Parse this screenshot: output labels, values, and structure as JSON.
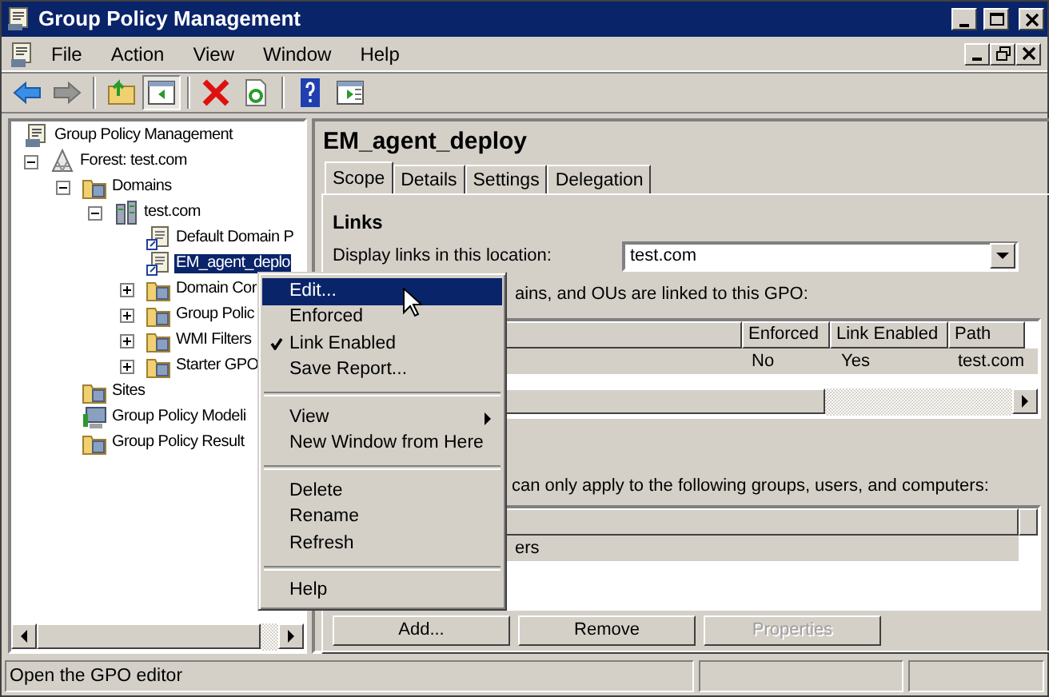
{
  "window": {
    "title": "Group Policy Management"
  },
  "menu_bar": [
    "File",
    "Action",
    "View",
    "Window",
    "Help"
  ],
  "toolbar": [
    {
      "kind": "back",
      "disabled": false
    },
    {
      "kind": "forward",
      "disabled": true
    },
    {
      "kind": "separator"
    },
    {
      "kind": "up",
      "disabled": false
    },
    {
      "kind": "tree",
      "disabled": false,
      "pressed": true
    },
    {
      "kind": "separator"
    },
    {
      "kind": "delete",
      "disabled": false
    },
    {
      "kind": "refresh",
      "disabled": false
    },
    {
      "kind": "separator"
    },
    {
      "kind": "help",
      "disabled": false
    },
    {
      "kind": "pane",
      "disabled": false
    }
  ],
  "tree": [
    {
      "label": "Group Policy Management",
      "kind": "console",
      "selected": false,
      "children": [
        {
          "label": "Forest: test.com",
          "kind": "forest",
          "expanded": true,
          "selected": false,
          "children": [
            {
              "label": "Domains",
              "kind": "folder",
              "expanded": true,
              "selected": false,
              "children": [
                {
                  "label": "test.com",
                  "kind": "domain",
                  "expanded": true,
                  "selected": false,
                  "children": [
                    {
                      "label": "Default Domain P",
                      "kind": "gpo",
                      "selected": false
                    },
                    {
                      "label": "EM_agent_deplo",
                      "kind": "gpo",
                      "selected": true
                    },
                    {
                      "label": "Domain Cor",
                      "kind": "folder",
                      "expanded": false,
                      "selected": false
                    },
                    {
                      "label": "Group Polic",
                      "kind": "folder",
                      "expanded": false,
                      "selected": false
                    },
                    {
                      "label": "WMI Filters",
                      "kind": "folder",
                      "expanded": false,
                      "selected": false
                    },
                    {
                      "label": "Starter GPO",
                      "kind": "folder",
                      "expanded": false,
                      "selected": false
                    }
                  ]
                }
              ]
            },
            {
              "label": "Sites",
              "kind": "folder",
              "selected": false
            },
            {
              "label": "Group Policy Modeli",
              "kind": "modeling",
              "selected": false
            },
            {
              "label": "Group Policy Result",
              "kind": "folder",
              "selected": false
            }
          ]
        }
      ]
    }
  ],
  "details": {
    "title": "EM_agent_deploy",
    "tabs": [
      {
        "label": "Scope",
        "selected": true
      },
      {
        "label": "Details",
        "selected": false
      },
      {
        "label": "Settings",
        "selected": false
      },
      {
        "label": "Delegation",
        "selected": false
      }
    ],
    "links_heading": "Links",
    "location_label": "Display links in this location:",
    "location_value": "test.com",
    "links_note": "ains, and OUs are linked to this GPO:",
    "links_table": {
      "columns": [
        "Enforced",
        "Link Enabled",
        "Path"
      ],
      "rows": [
        {
          "cells": [
            "No",
            "Yes",
            "test.com"
          ],
          "selected": true
        }
      ]
    },
    "filter_note": "can only apply to the following groups, users, and computers:",
    "filter_table": {
      "rows": [
        {
          "name": "ers",
          "selected": true
        }
      ]
    },
    "buttons": [
      {
        "label": "Add...",
        "disabled": false
      },
      {
        "label": "Remove",
        "disabled": false
      },
      {
        "label": "Properties",
        "disabled": true
      }
    ]
  },
  "context_menu": [
    {
      "kind": "item",
      "label": "Edit...",
      "selected": true,
      "checked": false,
      "submenu": false
    },
    {
      "kind": "item",
      "label": "Enforced",
      "selected": false,
      "checked": false,
      "submenu": false
    },
    {
      "kind": "item",
      "label": "Link Enabled",
      "selected": false,
      "checked": true,
      "submenu": false
    },
    {
      "kind": "item",
      "label": "Save Report...",
      "selected": false,
      "checked": false,
      "submenu": false
    },
    {
      "kind": "separator"
    },
    {
      "kind": "item",
      "label": "View",
      "selected": false,
      "checked": false,
      "submenu": true
    },
    {
      "kind": "item",
      "label": "New Window from Here",
      "selected": false,
      "checked": false,
      "submenu": false
    },
    {
      "kind": "separator"
    },
    {
      "kind": "item",
      "label": "Delete",
      "selected": false,
      "checked": false,
      "submenu": false
    },
    {
      "kind": "item",
      "label": "Rename",
      "selected": false,
      "checked": false,
      "submenu": false
    },
    {
      "kind": "item",
      "label": "Refresh",
      "selected": false,
      "checked": false,
      "submenu": false
    },
    {
      "kind": "separator"
    },
    {
      "kind": "item",
      "label": "Help",
      "selected": false,
      "checked": false,
      "submenu": false
    }
  ],
  "status_bar": [
    "Open the GPO editor"
  ]
}
